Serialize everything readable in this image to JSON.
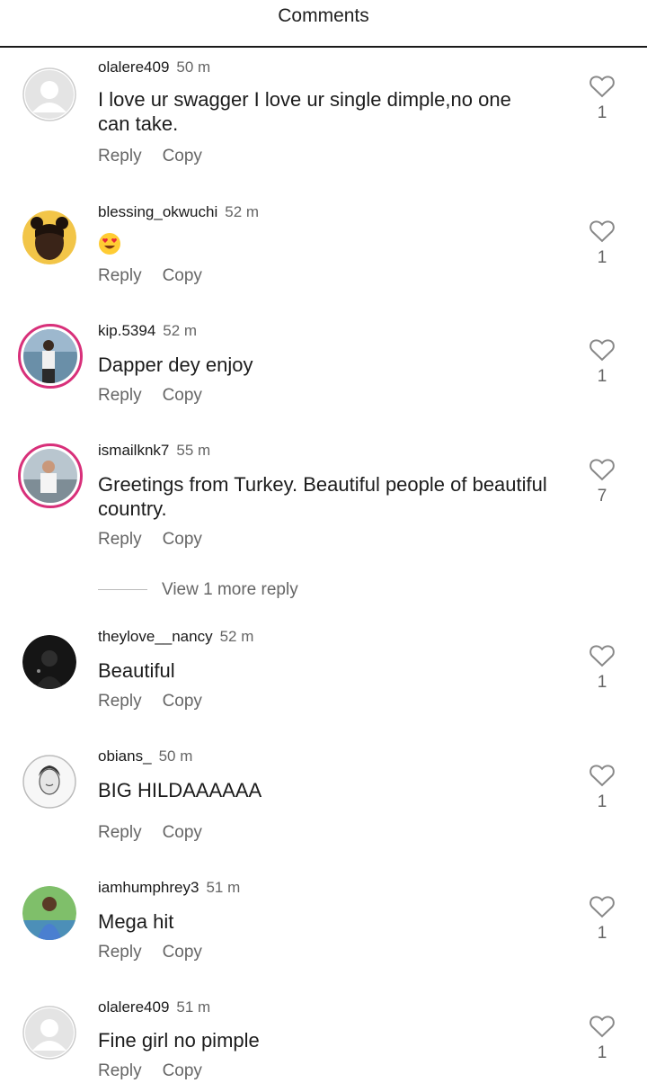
{
  "header": {
    "title": "Comments"
  },
  "actions": {
    "reply": "Reply",
    "copy": "Copy"
  },
  "more_replies": "View 1 more reply",
  "colors": {
    "story_ring": "#d8307a",
    "muted": "#666666",
    "divider": "#1a1a1a"
  },
  "comments": [
    {
      "user": "olalere409",
      "time": "50 m",
      "text": "I love ur swagger I love ur single dimple,no one can take.",
      "likes": "1",
      "avatar": "default-avatar-icon"
    },
    {
      "user": "blessing_okwuchi",
      "time": "52 m",
      "text": "",
      "emoji": "heart-eyes-emoji-icon",
      "likes": "1",
      "avatar": "photo-avatar"
    },
    {
      "user": "kip.5394",
      "time": "52 m",
      "text": "Dapper dey enjoy",
      "likes": "1",
      "avatar": "story-avatar"
    },
    {
      "user": "ismailknk7",
      "time": "55 m",
      "text": "Greetings from Turkey. Beautiful people of beautiful country.",
      "likes": "7",
      "avatar": "story-avatar"
    },
    {
      "user": "theylove__nancy",
      "time": "52 m",
      "text": "Beautiful",
      "likes": "1",
      "avatar": "photo-avatar"
    },
    {
      "user": "obians_",
      "time": "50 m",
      "text": "BIG HILDAAAAAA",
      "likes": "1",
      "avatar": "photo-avatar"
    },
    {
      "user": "iamhumphrey3",
      "time": "51 m",
      "text": "Mega hit",
      "likes": "1",
      "avatar": "photo-avatar"
    },
    {
      "user": "olalere409",
      "time": "51 m",
      "text": "Fine girl no pimple",
      "likes": "1",
      "avatar": "default-avatar-icon"
    }
  ]
}
